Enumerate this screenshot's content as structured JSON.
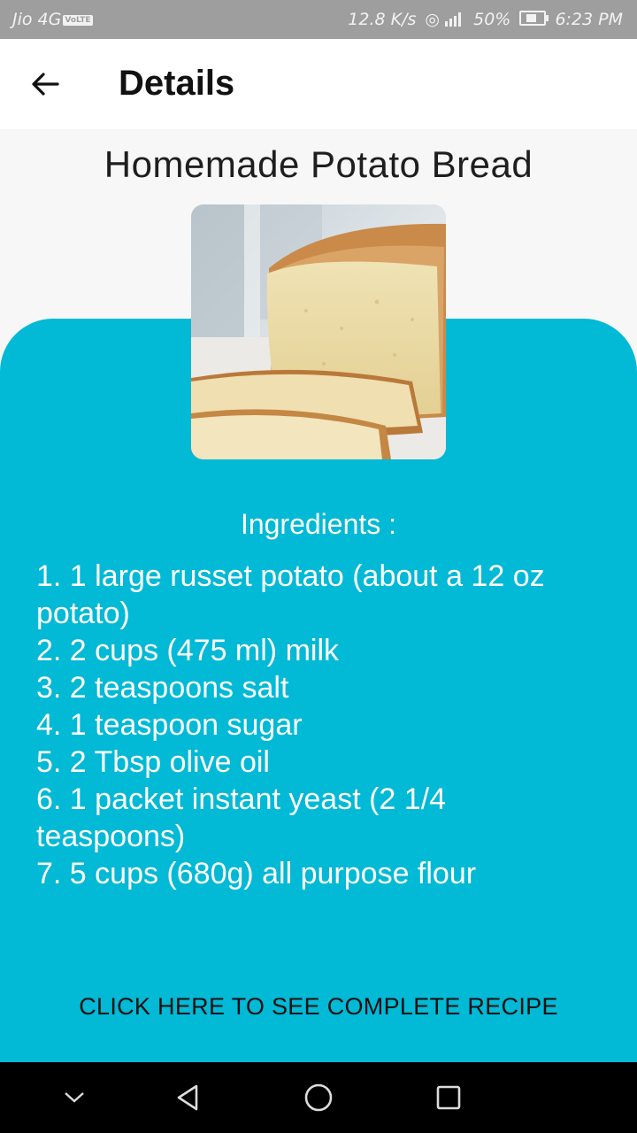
{
  "status_bar": {
    "carrier": "Jio 4G",
    "volte": "VoLTE",
    "speed": "12.8 K/s",
    "battery": "50%",
    "time": "6:23 PM"
  },
  "app_bar": {
    "back_icon": "arrow-left-icon",
    "title": "Details"
  },
  "recipe": {
    "title": "Homemade Potato Bread",
    "image": "potato-bread-photo",
    "ingredients_heading": "Ingredients :",
    "ingredients": [
      "1. 1 large russet potato (about a 12 oz potato)",
      "2. 2 cups (475 ml) milk",
      "3. 2 teaspoons salt",
      "4. 1 teaspoon sugar",
      "5. 2 Tbsp olive oil",
      "6. 1 packet instant yeast (2 1/4 teaspoons)",
      "7. 5 cups (680g) all purpose flour"
    ],
    "link_label": "CLICK HERE TO SEE COMPLETE RECIPE"
  },
  "nav_bar": {
    "icons": [
      "chevron-down-icon",
      "back-triangle-icon",
      "home-circle-icon",
      "recents-square-icon"
    ]
  },
  "colors": {
    "accent": "#02b9d6",
    "background": "#f7f7f8",
    "status_bar": "#9e9e9e"
  }
}
